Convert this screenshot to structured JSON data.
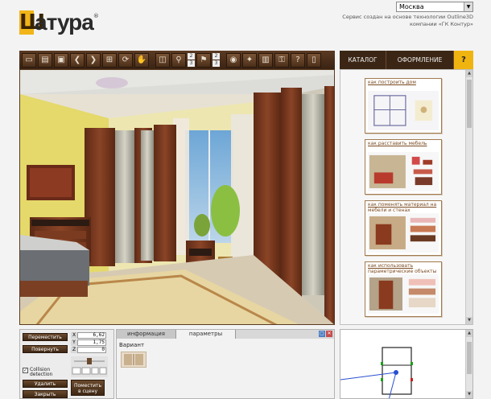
{
  "header": {
    "logo_letter": "Ш",
    "logo_text": "атура",
    "logo_reg": "®",
    "city_value": "Москва",
    "city_arrow": "▼",
    "credit_line1": "Сервис создан на основе технологии Outline3D",
    "credit_line2": "компании «ГК Контур»"
  },
  "toolbar": {
    "icons": [
      "new-icon",
      "open-icon",
      "save-icon",
      "undo-icon",
      "redo-icon",
      "select-area-icon",
      "camera-rotate-icon",
      "hand-icon",
      "measure-icon",
      "zoom-icon",
      "walk-icon",
      "view-2d-icon",
      "view-3d-icon",
      "camera-icon",
      "render-icon",
      "print-icon",
      "lock-icon",
      "help-icon",
      "info-icon"
    ],
    "num_top": "2",
    "num_bottom": "3",
    "help_glyph": "?"
  },
  "right_tabs": {
    "catalog": "КАТАЛОГ",
    "design": "ОФОРМЛЕНИЕ",
    "help": "?"
  },
  "catalog_cards": [
    {
      "title": "как построить дом"
    },
    {
      "title": "как расставить мебель"
    },
    {
      "title": "как поменять материал на мебели и стенах"
    },
    {
      "title": "как использовать параметрические объекты"
    }
  ],
  "controls": {
    "move": "Переместить",
    "rotate": "Повернуть",
    "delete": "Удалить",
    "close": "Закрыть",
    "x_label": "X",
    "x_value": "6,62",
    "y_label": "Y",
    "y_value": "1,75",
    "z_label": "Z",
    "z_value": "0",
    "collision_label_1": "Collision",
    "collision_label_2": "detection",
    "collision_check": "✓",
    "place_label_1": "Поместить",
    "place_label_2": "в сцену"
  },
  "params_panel": {
    "tab_info": "информация",
    "tab_params": "параметры",
    "variant_label": "Вариант"
  },
  "colors": {
    "brown_dark": "#3a2313",
    "accent_yellow": "#f0b410"
  }
}
